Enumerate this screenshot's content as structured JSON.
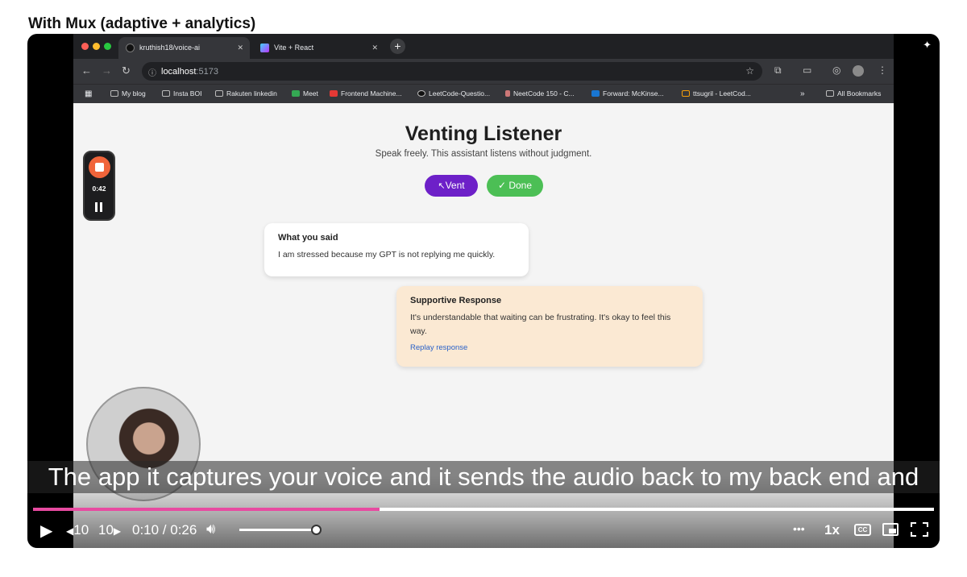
{
  "page_heading": "With Mux (adaptive + analytics)",
  "browser": {
    "tabs": [
      {
        "label": "kruthish18/voice-ai"
      },
      {
        "label": "Vite + React"
      }
    ],
    "url_host": "localhost",
    "url_port": ":5173",
    "bookmarks": [
      "My blog",
      "Insta BOI",
      "Rakuten linkedin",
      "Meet",
      "Frontend Machine...",
      "LeetCode-Questio...",
      "NeetCode 150 - C...",
      "Forward: McKinse...",
      "ttsugril - LeetCod..."
    ],
    "all_bookmarks": "All Bookmarks",
    "more_bookmarks": "»"
  },
  "app": {
    "title": "Venting Listener",
    "subtitle": "Speak freely. This assistant listens without judgment.",
    "vent_label": "Vent",
    "done_label": "✓ Done",
    "said_heading": "What you said",
    "said_text": "I am stressed because my GPT is not replying me quickly.",
    "response_heading": "Supportive Response",
    "response_text": "It's understandable that waiting can be frustrating. It's okay to feel this way.",
    "replay_label": "Replay response"
  },
  "recorder": {
    "time": "0:42"
  },
  "caption": "The app it captures your voice and it sends the audio back to my back end and",
  "player": {
    "progress": 0.385,
    "volume": 0.95,
    "rewind_label": "10",
    "forward_label": "10",
    "time_display": "0:10 / 0:26",
    "speed": "1x",
    "cc": "CC",
    "more": "•••"
  },
  "colors": {
    "vent": "#6d20c8",
    "done": "#4cbf55",
    "progress": "#e74aa0",
    "response_bg": "#fbe9d3"
  }
}
